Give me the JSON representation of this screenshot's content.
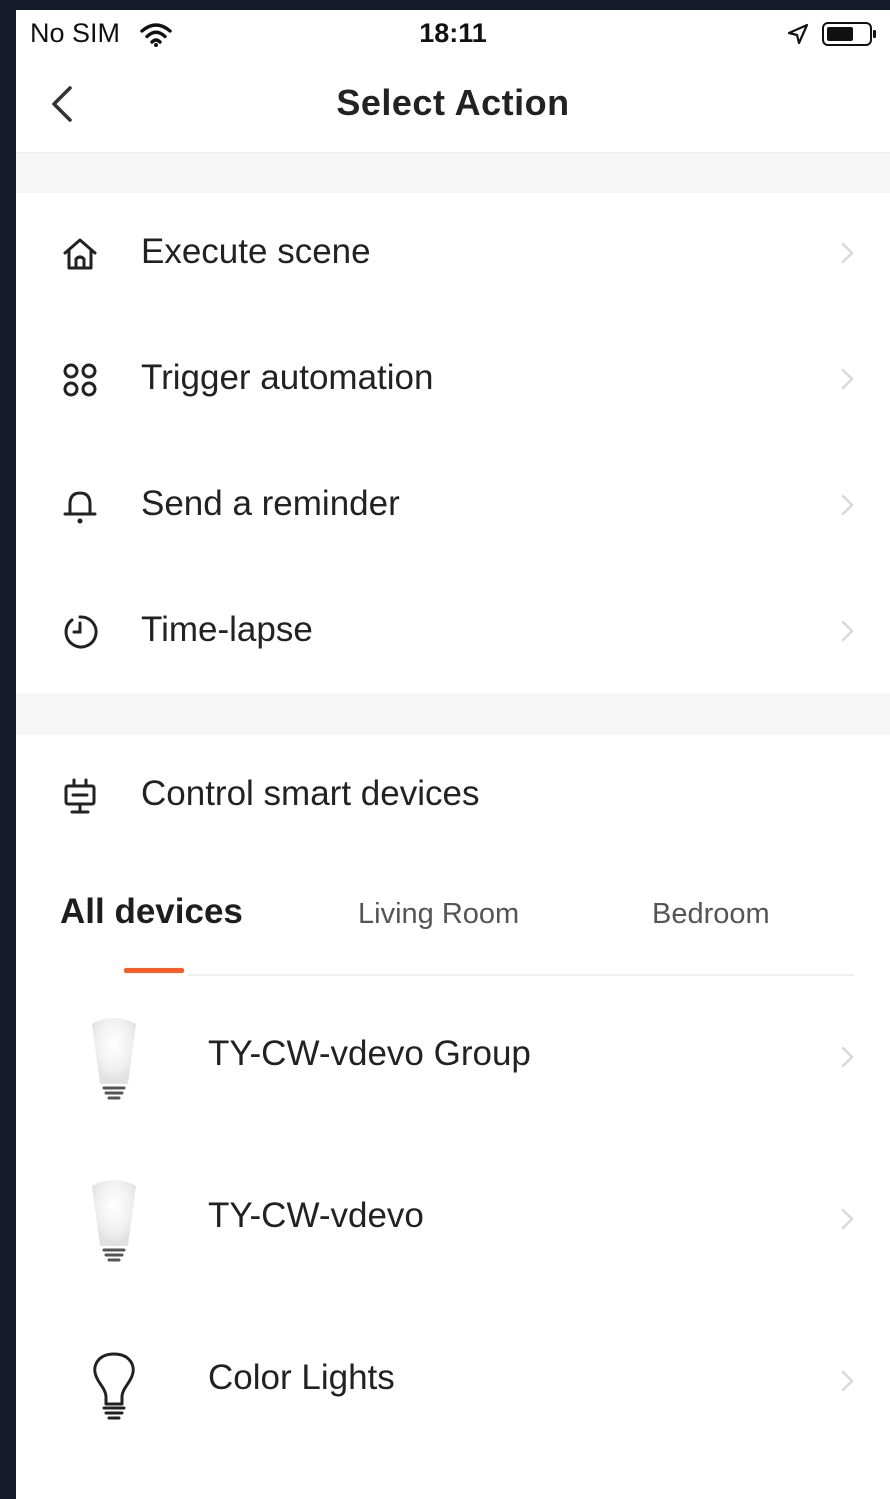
{
  "status_bar": {
    "carrier": "No SIM",
    "time": "18:11"
  },
  "nav": {
    "title": "Select Action"
  },
  "menu": {
    "items": [
      {
        "label": "Execute scene",
        "icon": "home-icon"
      },
      {
        "label": "Trigger automation",
        "icon": "automation-icon"
      },
      {
        "label": "Send a reminder",
        "icon": "bell-icon"
      },
      {
        "label": "Time-lapse",
        "icon": "timer-icon"
      }
    ]
  },
  "control": {
    "label": "Control smart devices",
    "icon": "device-plug-icon"
  },
  "tabs": {
    "items": [
      "All devices",
      "Living Room",
      "Bedroom"
    ],
    "selected": "All devices",
    "accent_color": "#ff5a1f"
  },
  "devices": {
    "items": [
      {
        "name": "TY-CW-vdevo Group",
        "icon": "bulb-glow-icon"
      },
      {
        "name": "TY-CW-vdevo",
        "icon": "bulb-glow-icon"
      },
      {
        "name": "Color Lights",
        "icon": "bulb-outline-icon"
      }
    ]
  }
}
